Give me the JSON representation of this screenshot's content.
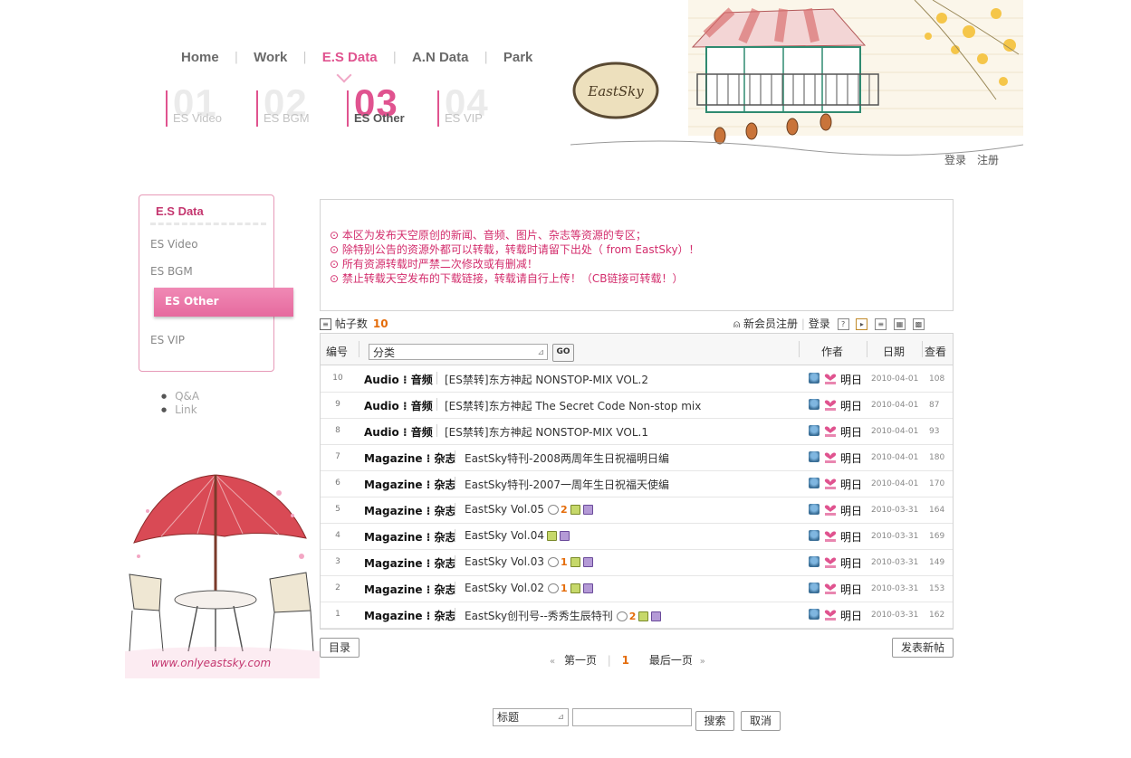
{
  "nav": {
    "items": [
      "Home",
      "Work",
      "E.S Data",
      "A.N Data",
      "Park"
    ],
    "active_index": 2
  },
  "subtabs": [
    {
      "num": "01",
      "label": "ES Video"
    },
    {
      "num": "02",
      "label": "ES BGM"
    },
    {
      "num": "03",
      "label": "ES Other"
    },
    {
      "num": "04",
      "label": "ES VIP"
    }
  ],
  "header": {
    "sign_text": "EastSky",
    "login": "登录",
    "register": "注册"
  },
  "sidebar": {
    "title": "E.S Data",
    "items": [
      "ES Video",
      "ES BGM",
      "ES Other",
      "ES VIP"
    ],
    "active": "ES Other",
    "links": [
      "Q&A",
      "Link"
    ]
  },
  "notice": [
    "⊙ 本区为发布天空原创的新闻、音频、图片、杂志等资源的专区；",
    "⊙ 除特别公告的资源外都可以转载，转载时请留下出处（ from EastSky）！",
    "⊙ 所有资源转载时严禁二次修改或有删减！",
    "⊙ 禁止转载天空发布的下载链接，转载请自行上传！（CB链接可转载！）"
  ],
  "list_meta": {
    "post_count_label": "帖子数",
    "post_count": "10",
    "new_member": "新会员注册",
    "login": "登录"
  },
  "table": {
    "col_num": "编号",
    "category_select": "分类",
    "go": "GO",
    "col_author": "作者",
    "col_date": "日期",
    "col_views": "查看",
    "rows": [
      {
        "num": "10",
        "cat": "Audio",
        "cat_cn": "音频",
        "title": "[ES禁转]东方神起  NONSTOP-MIX VOL.2",
        "comments": "",
        "author": "明日",
        "date": "2010-04-01",
        "views": "108"
      },
      {
        "num": "9",
        "cat": "Audio",
        "cat_cn": "音频",
        "title": "[ES禁转]东方神起  The Secret Code Non-stop mix",
        "comments": "",
        "author": "明日",
        "date": "2010-04-01",
        "views": "87"
      },
      {
        "num": "8",
        "cat": "Audio",
        "cat_cn": "音频",
        "title": "[ES禁转]东方神起  NONSTOP-MIX VOL.1",
        "comments": "",
        "author": "明日",
        "date": "2010-04-01",
        "views": "93"
      },
      {
        "num": "7",
        "cat": "Magazine",
        "cat_cn": "杂志",
        "title": "EastSky特刊-2008两周年生日祝福明日编",
        "comments": "",
        "author": "明日",
        "date": "2010-04-01",
        "views": "180"
      },
      {
        "num": "6",
        "cat": "Magazine",
        "cat_cn": "杂志",
        "title": "EastSky特刊-2007一周年生日祝福天使编",
        "comments": "",
        "author": "明日",
        "date": "2010-04-01",
        "views": "170"
      },
      {
        "num": "5",
        "cat": "Magazine",
        "cat_cn": "杂志",
        "title": "EastSky Vol.05",
        "comments": "2",
        "author": "明日",
        "date": "2010-03-31",
        "views": "164"
      },
      {
        "num": "4",
        "cat": "Magazine",
        "cat_cn": "杂志",
        "title": "EastSky Vol.04",
        "comments": "",
        "author": "明日",
        "date": "2010-03-31",
        "views": "169"
      },
      {
        "num": "3",
        "cat": "Magazine",
        "cat_cn": "杂志",
        "title": "EastSky Vol.03",
        "comments": "1",
        "author": "明日",
        "date": "2010-03-31",
        "views": "149"
      },
      {
        "num": "2",
        "cat": "Magazine",
        "cat_cn": "杂志",
        "title": "EastSky Vol.02",
        "comments": "1",
        "author": "明日",
        "date": "2010-03-31",
        "views": "153"
      },
      {
        "num": "1",
        "cat": "Magazine",
        "cat_cn": "杂志",
        "title": "EastSky创刊号--秀秀生辰特刊",
        "comments": "2",
        "author": "明日",
        "date": "2010-03-31",
        "views": "162"
      }
    ]
  },
  "bottom": {
    "list_button": "目录",
    "first_page": "第一页",
    "current_page": "1",
    "last_page": "最后一页",
    "new_post_button": "发表新帖",
    "search_field_select": "标题",
    "search_button": "搜索",
    "cancel_button": "取消"
  },
  "footer_art_text": "www.onlyeastsky.com",
  "colors": {
    "accent": "#e0538f",
    "notice": "#d32d6c",
    "count": "#e46c0a"
  }
}
